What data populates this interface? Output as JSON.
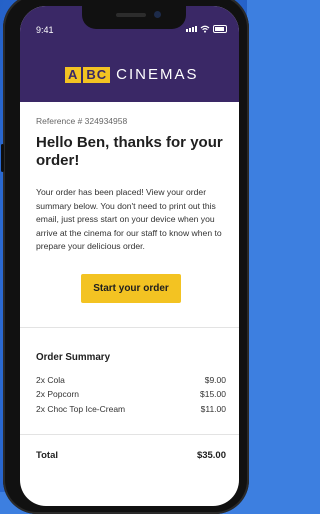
{
  "status_bar": {
    "time": "9:41"
  },
  "brand": {
    "logo_left": "A",
    "logo_mid": "BC",
    "logo_word": "CINEMAS"
  },
  "email": {
    "reference": "Reference # 324934958",
    "greeting": "Hello Ben, thanks for your order!",
    "body": "Your order has been placed! View your order summary below. You don't need to print out this email, just press start on your device when you arrive at the cinema for our staff to know when to prepare your delicious order.",
    "cta_label": "Start your order"
  },
  "summary": {
    "title": "Order Summary",
    "items": [
      {
        "name": "2x Cola",
        "price": "$9.00"
      },
      {
        "name": "2x Popcorn",
        "price": "$15.00"
      },
      {
        "name": "2x Choc Top Ice-Cream",
        "price": "$11.00"
      }
    ],
    "total_label": "Total",
    "total_value": "$35.00"
  },
  "colors": {
    "brand_purple": "#3a2866",
    "accent_yellow": "#f3c322",
    "background_blue": "#3d7fe0"
  }
}
